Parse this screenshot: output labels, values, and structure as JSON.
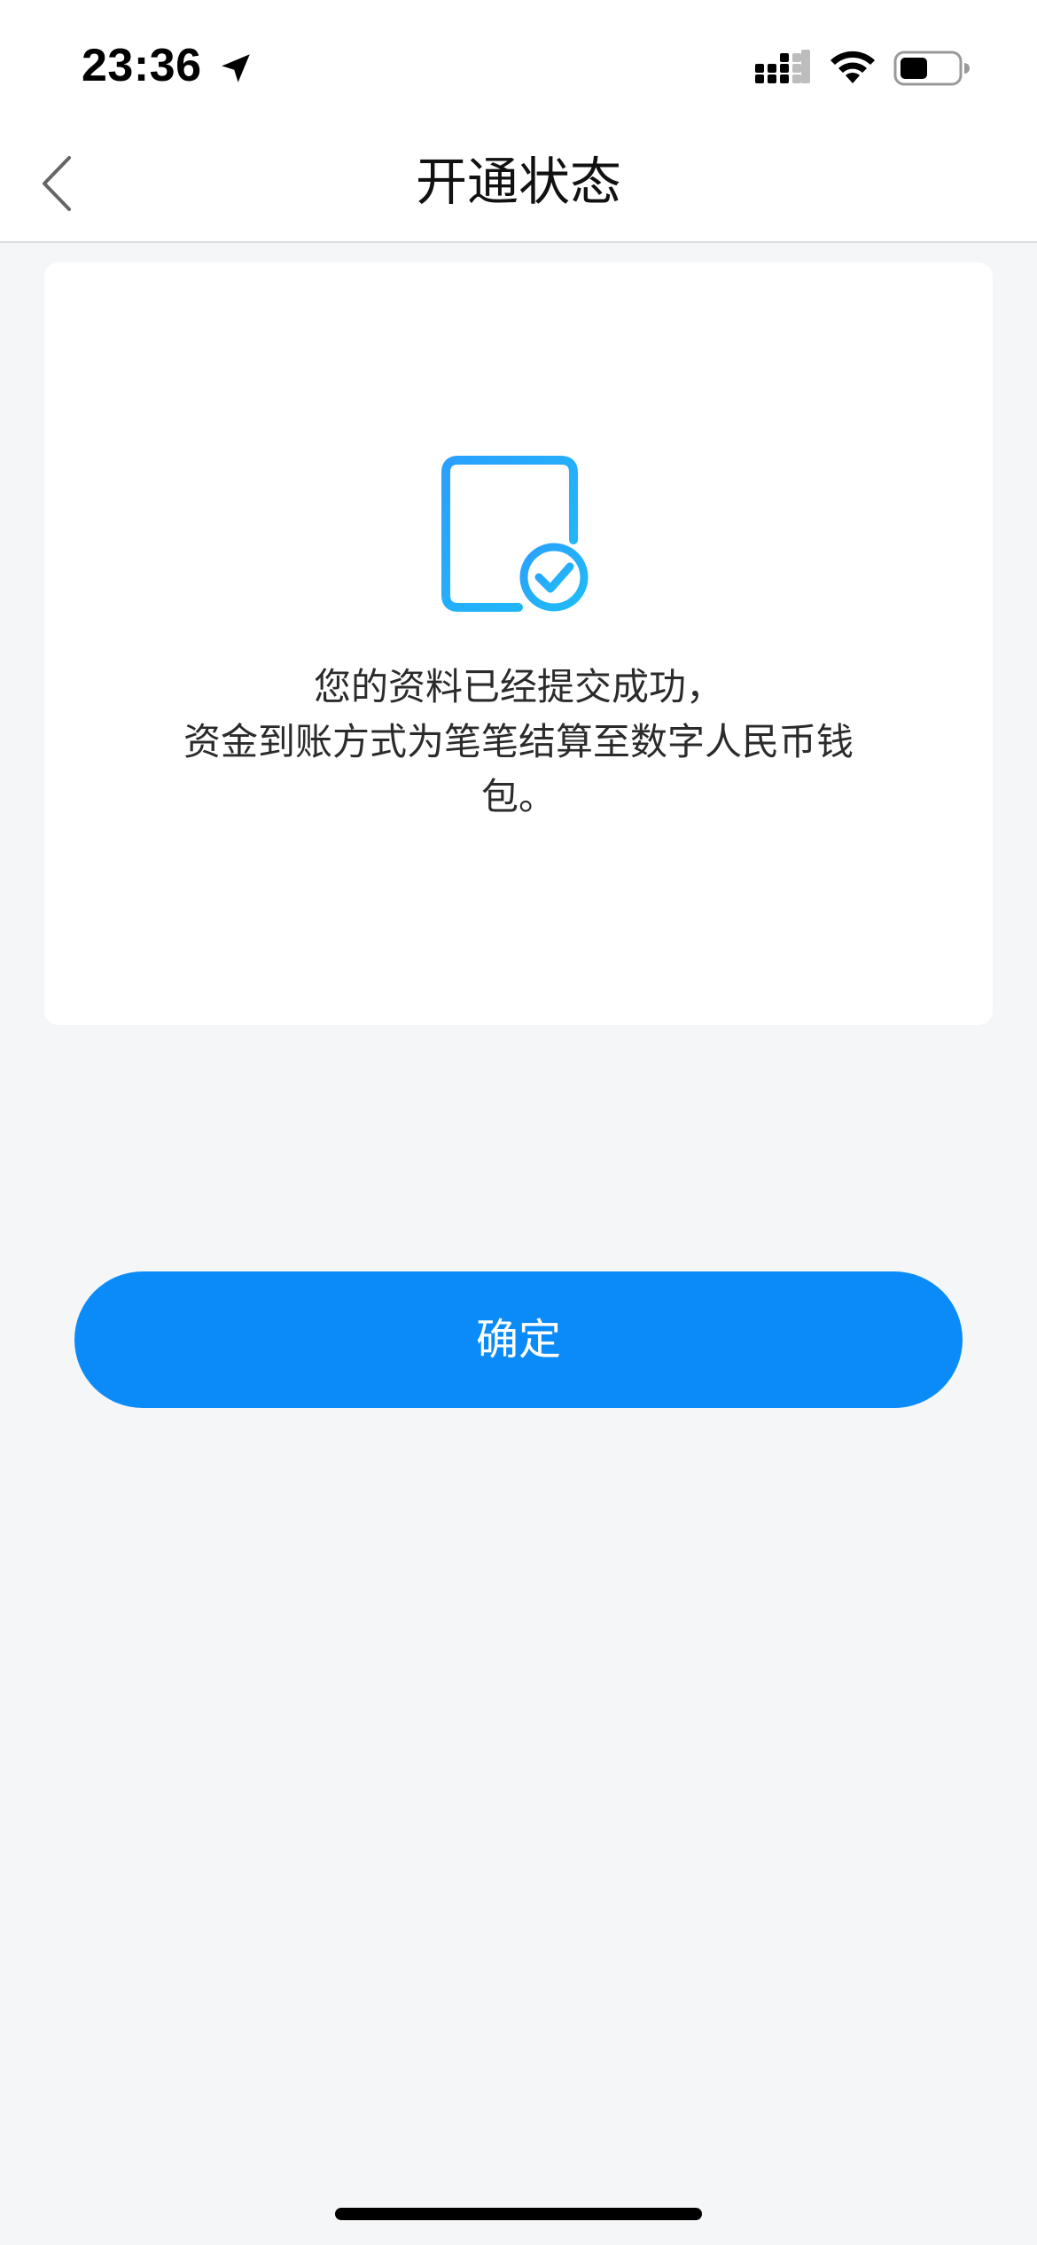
{
  "status_bar": {
    "time": "23:36",
    "icons": [
      "location-arrow-icon",
      "cellular-signal-icon",
      "wifi-icon",
      "battery-icon"
    ]
  },
  "nav": {
    "title": "开通状态",
    "back_icon": "chevron-left-icon"
  },
  "card": {
    "icon": "document-check-icon",
    "message_lines": [
      "您的资料已经提交成功，",
      "资金到账方式为笔笔结算至数字人民币钱",
      "包。"
    ]
  },
  "actions": {
    "confirm_label": "确定"
  },
  "colors": {
    "accent": "#0a8bf8",
    "background": "#f5f6f8",
    "card": "#ffffff"
  }
}
